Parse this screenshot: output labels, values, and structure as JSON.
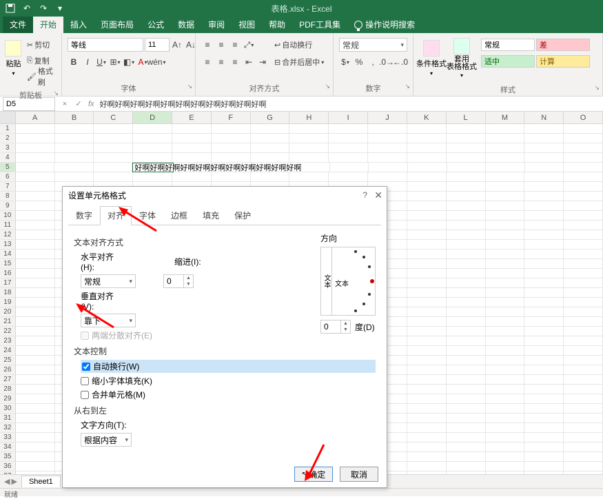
{
  "titlebar": {
    "title": "表格.xlsx - Excel"
  },
  "tabs": {
    "file": "文件",
    "items": [
      "开始",
      "插入",
      "页面布局",
      "公式",
      "数据",
      "审阅",
      "视图",
      "帮助",
      "PDF工具集"
    ],
    "active": "开始",
    "op_hint": "操作说明搜索"
  },
  "ribbon": {
    "clipboard": {
      "paste": "粘贴",
      "cut": "剪切",
      "copy": "复制",
      "painter": "格式刷",
      "label": "剪贴板"
    },
    "font": {
      "name": "等线",
      "size": "11",
      "label": "字体"
    },
    "align": {
      "wrap": "自动换行",
      "merge": "合并后居中",
      "label": "对齐方式"
    },
    "number": {
      "format": "常规",
      "label": "数字"
    },
    "styles": {
      "cond": "条件格式",
      "table": "套用\n表格格式",
      "normal": "常规",
      "bad": "差",
      "good": "适中",
      "calc": "计算",
      "label": "样式"
    }
  },
  "formula_bar": {
    "ref": "D5",
    "value": "好啊好啊好啊好啊好啊好啊好啊好啊好啊好啊好啊"
  },
  "columns": [
    "A",
    "B",
    "C",
    "D",
    "E",
    "F",
    "G",
    "H",
    "I",
    "J",
    "K",
    "L",
    "M",
    "N",
    "O"
  ],
  "active_cell": {
    "col": "D",
    "row": 5,
    "display": "好啊好啊好啊好啊好啊好啊好啊好啊好啊好啊好啊"
  },
  "sheet": {
    "name": "Sheet1"
  },
  "status": "就绪",
  "dialog": {
    "title": "设置单元格格式",
    "tabs": [
      "数字",
      "对齐",
      "字体",
      "边框",
      "填充",
      "保护"
    ],
    "active_tab": "对齐",
    "text_align_section": "文本对齐方式",
    "h_align_label": "水平对齐(H):",
    "h_align_value": "常规",
    "indent_label": "缩进(I):",
    "indent_value": "0",
    "v_align_label": "垂直对齐(V):",
    "v_align_value": "靠下",
    "justify_label": "两端分散对齐(E)",
    "text_control_section": "文本控制",
    "wrap_label": "自动换行(W)",
    "shrink_label": "缩小字体填充(K)",
    "merge_label": "合并单元格(M)",
    "rtl_section": "从右到左",
    "dir_label": "文字方向(T):",
    "dir_value": "根据内容",
    "orient_label": "方向",
    "orient_text": "文本",
    "orient_vtext": "文本",
    "degree_label": "度(D)",
    "degree_value": "0",
    "ok": "确定",
    "cancel": "取消"
  }
}
